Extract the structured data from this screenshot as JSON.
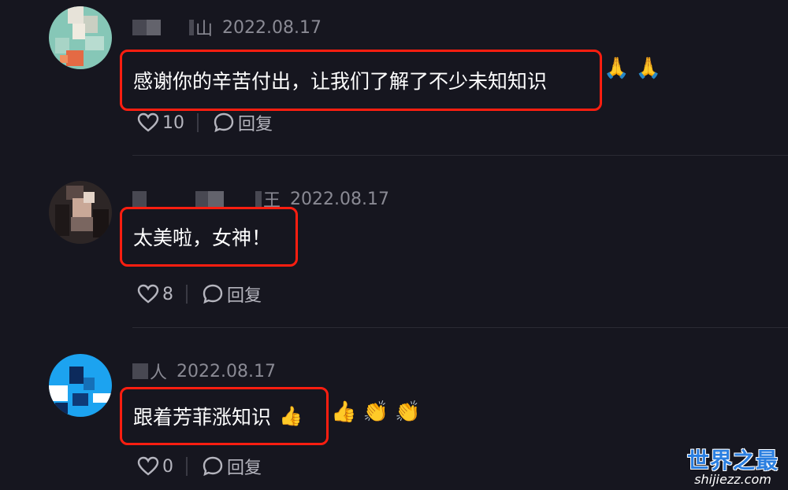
{
  "comments": [
    {
      "name_visible": "山",
      "date": "2022.08.17",
      "text": "感谢你的辛苦付出，让我们了解了不少未知知识",
      "emojis": "🙏 🙏",
      "likes": "10",
      "reply_label": "回复",
      "avatar_colors": [
        "#86c7b7",
        "#e7e3d9",
        "#e46a44"
      ]
    },
    {
      "name_visible": "王",
      "date": "2022.08.17",
      "text": "太美啦，女神！",
      "emojis": "",
      "likes": "8",
      "reply_label": "回复",
      "avatar_colors": [
        "#2d2626",
        "#c9a897",
        "#7a6660"
      ]
    },
    {
      "name_visible": "人",
      "date": "2022.08.17",
      "text": "跟着芳菲涨知识",
      "emojis": "👍",
      "emojis_after": "👍 👏 👏",
      "likes": "0",
      "reply_label": "回复",
      "avatar_colors": [
        "#1ca3f0",
        "#0c2a5c",
        "#ffffff"
      ]
    }
  ],
  "watermark": {
    "top": "世界之最",
    "bottom": "shijiezz.com"
  },
  "colors": {
    "background": "#16161f",
    "highlight_border": "#ff1e10",
    "meta_text": "#8a8a94",
    "action_text": "#b5b5be"
  }
}
